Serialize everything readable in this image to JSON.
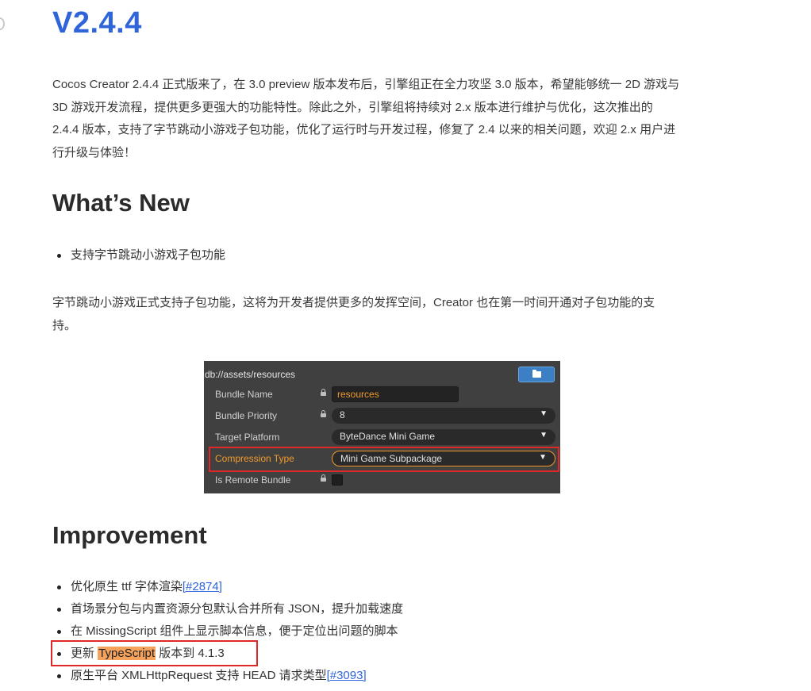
{
  "version_title": "V2.4.4",
  "intro_lines": [
    "Cocos Creator 2.4.4 正式版来了，在 3.0 preview 版本发布后，引擎组正在全力攻坚 3.0 版本，希望能够统一 2D 游戏与",
    "3D 游戏开发流程，提供更多更强大的功能特性。除此之外，引擎组将持续对 2.x 版本进行维护与优化，这次推出的",
    "2.4.4 版本，支持了字节跳动小游戏子包功能，优化了运行时与开发过程，修复了 2.4 以来的相关问题，欢迎 2.x 用户进",
    "行升级与体验！"
  ],
  "whats_new": {
    "heading": "What’s New",
    "bullets": [
      "支持字节跳动小游戏子包功能"
    ],
    "desc_lines": [
      "字节跳动小游戏正式支持子包功能，这将为开发者提供更多的发挥空间，Creator 也在第一时间开通对子包功能的支",
      "持。"
    ]
  },
  "editor_panel": {
    "path": "db://assets/resources",
    "rows": [
      {
        "label": "Bundle Name",
        "value": "resources"
      },
      {
        "label": "Bundle Priority",
        "value": "8"
      },
      {
        "label": "Target Platform",
        "value": "ByteDance Mini Game"
      },
      {
        "label": "Compression Type",
        "value": "Mini Game Subpackage"
      },
      {
        "label": "Is Remote Bundle",
        "value": ""
      }
    ],
    "accent_color": "#f19a2b"
  },
  "improvement": {
    "heading": "Improvement",
    "items": [
      {
        "text": "优化原生 ttf 字体渲染",
        "link": "[#2874]"
      },
      {
        "text": "首场景分包与内置资源分包默认合并所有 JSON，提升加载速度"
      },
      {
        "text": "在 MissingScript 组件上显示脚本信息，便于定位出问题的脚本"
      },
      {
        "pre": "更新 ",
        "highlight": "TypeScript",
        "post": " 版本到 4.1.3"
      },
      {
        "text": "原生平台 XMLHttpRequest 支持 HEAD 请求类型",
        "link": "[#3093]"
      }
    ]
  },
  "colors": {
    "title_blue": "#2f65d9",
    "annotation_red": "#e02828",
    "highlight_orange": "#f5a25c"
  }
}
